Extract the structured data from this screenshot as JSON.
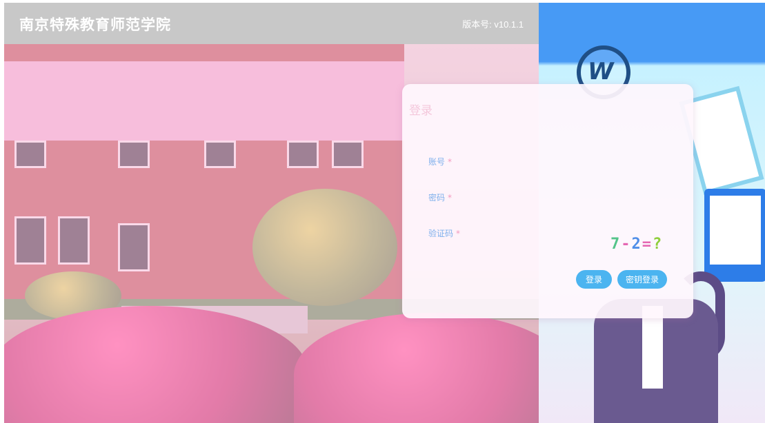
{
  "header": {
    "school_name": "南京特殊教育师范学院",
    "version": "版本号: v10.1.1"
  },
  "login": {
    "title": "登录",
    "account_label": "账号",
    "password_label": "密码",
    "captcha_label": "验证码",
    "required_marker": "*",
    "captcha_text": "7-2=?",
    "login_button": "登录",
    "key_login_button": "密钥登录"
  },
  "colors": {
    "header_bg": "#c8c8c8",
    "right_panel_top": "#479af5",
    "button": "#4bb4f0",
    "label": "#7fb0ec"
  },
  "icons": {
    "logo": "school-logo-icon"
  }
}
